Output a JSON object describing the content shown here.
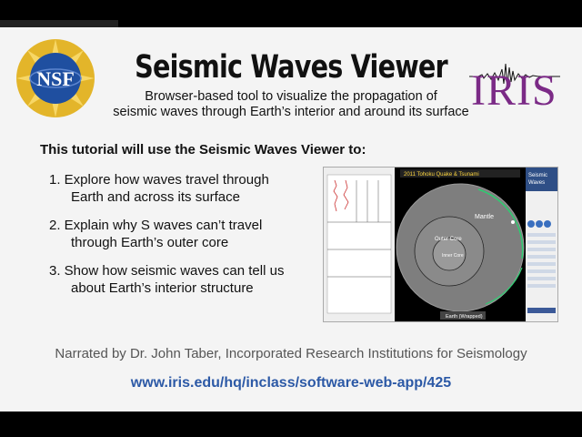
{
  "header": {
    "title": "Seismic Waves Viewer",
    "subtitle_line1": "Browser-based tool to visualize the propagation of",
    "subtitle_line2": "seismic waves through Earth’s interior and around its surface",
    "left_logo_text": "NSF",
    "right_logo_text": "IRIS"
  },
  "body": {
    "intro": "This tutorial will use the Seismic Waves Viewer to:",
    "items": [
      {
        "line1": "1. Explore how waves travel through",
        "line2": "Earth and across its surface"
      },
      {
        "line1": "2. Explain why S waves can’t travel",
        "line2": "through Earth’s outer core"
      },
      {
        "line1": "3. Show how seismic waves can tell us",
        "line2": "about Earth’s interior structure"
      }
    ]
  },
  "screenshot": {
    "event_title": "2011 Tohoku Quake & Tsunami",
    "panel_title_line1": "Seismic",
    "panel_title_line2": "Waves",
    "label_mantle": "Mantle",
    "label_outer_core": "Outer Core",
    "label_inner_core": "Inner Core",
    "earth_label": "Earth (Wrapped)"
  },
  "footer": {
    "narrator": "Narrated by Dr. John Taber, Incorporated Research Institutions for Seismology",
    "url": "www.iris.edu/hq/inclass/software-web-app/425"
  },
  "colors": {
    "iris_purple": "#7b2a86",
    "url_blue": "#2c59a6",
    "nsf_blue": "#1f4fa0",
    "nsf_gold": "#e3b52a"
  }
}
